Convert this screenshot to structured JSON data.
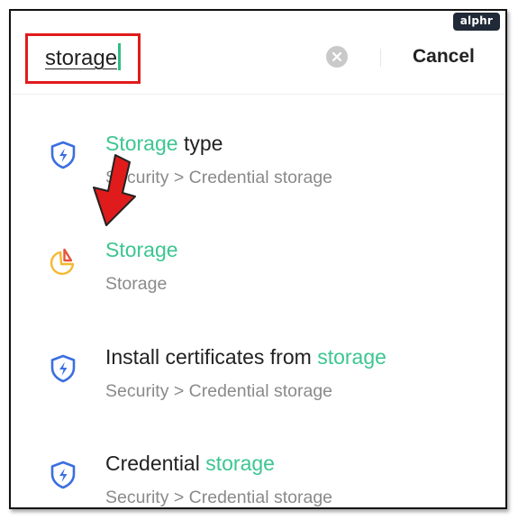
{
  "watermark": "alphr",
  "search": {
    "query": "storage",
    "cancel_label": "Cancel"
  },
  "results": [
    {
      "title_parts": [
        "Storage",
        " type"
      ],
      "highlight_first": true,
      "subtitle": "Security > Credential storage",
      "icon": "shield-icon"
    },
    {
      "title_parts": [
        "Storage",
        ""
      ],
      "highlight_first": true,
      "subtitle": "Storage",
      "icon": "storage-pie-icon"
    },
    {
      "title_parts": [
        "Install certificates from ",
        "storage"
      ],
      "highlight_first": false,
      "subtitle": "Security > Credential storage",
      "icon": "shield-icon"
    },
    {
      "title_parts": [
        "Credential ",
        "storage"
      ],
      "highlight_first": false,
      "subtitle": "Security > Credential storage",
      "icon": "shield-icon"
    }
  ],
  "colors": {
    "accent": "#3cc690",
    "shield": "#3b6ee0",
    "highlight_box": "#e01b1b",
    "arrow": "#e01b1b"
  }
}
